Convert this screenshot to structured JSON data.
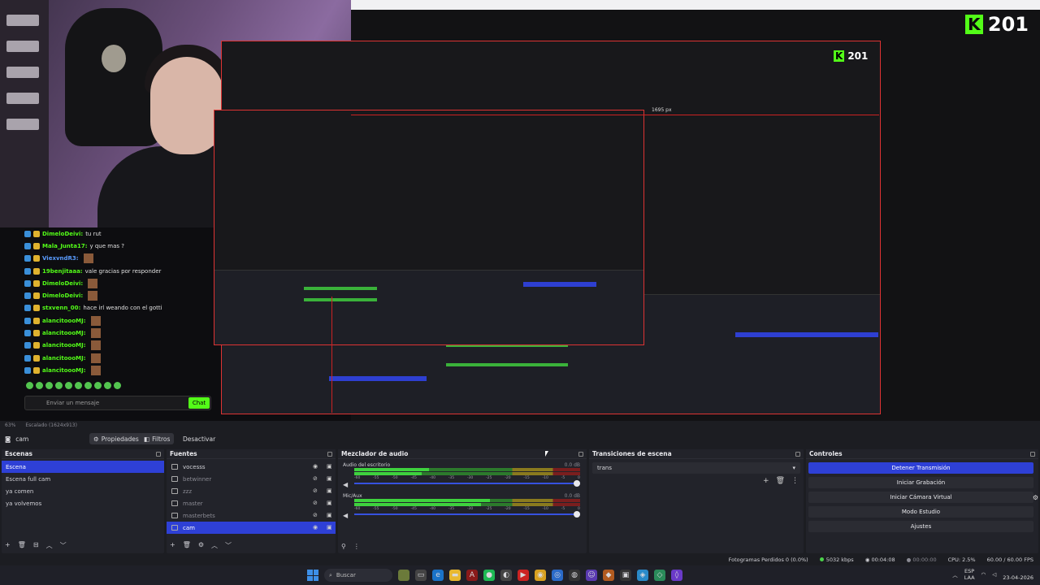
{
  "capture": {
    "kick_count": "201",
    "nested_kick_count": "201",
    "ruler_label": "1695 px",
    "chat_messages": [
      {
        "user": "DimeloDeivi:",
        "text": "tu rut",
        "color": "green"
      },
      {
        "user": "Mala_Junta17:",
        "text": "y que mas ?",
        "color": "green"
      },
      {
        "user": "ViexvndR3:",
        "text": "",
        "color": "blue"
      },
      {
        "user": "19benjitaaa:",
        "text": "vale gracias por responder",
        "color": "green"
      },
      {
        "user": "DimeloDeivi:",
        "text": "",
        "color": "green"
      },
      {
        "user": "DimeloDeivi:",
        "text": "",
        "color": "green"
      },
      {
        "user": "stxvenn_00:",
        "text": "hace irl weando con el gotti",
        "color": "green"
      },
      {
        "user": "alancitoooMJ:",
        "text": "",
        "color": "green"
      },
      {
        "user": "alancitoooMJ:",
        "text": "",
        "color": "green"
      },
      {
        "user": "alancitoooMJ:",
        "text": "",
        "color": "green"
      },
      {
        "user": "alancitoooMJ:",
        "text": "",
        "color": "green"
      },
      {
        "user": "alancitoooMJ:",
        "text": "",
        "color": "green"
      }
    ],
    "chat_placeholder": "Enviar un mensaje",
    "chat_button": "Chat"
  },
  "status_mini": {
    "zoom": "63%",
    "scaled": "Escalado (1624x913)"
  },
  "toolbar": {
    "source_name": "cam",
    "properties": "Propiedades",
    "filters": "Filtros",
    "deactivate": "Desactivar"
  },
  "scenes": {
    "title": "Escenas",
    "items": [
      "Escena",
      "Escena full cam",
      "ya comen",
      "ya volvemos"
    ],
    "selected": 0
  },
  "sources": {
    "title": "Fuentes",
    "items": [
      {
        "name": "vocesss",
        "visible": true
      },
      {
        "name": "betwinner",
        "visible": false
      },
      {
        "name": "zzz",
        "visible": false
      },
      {
        "name": "master",
        "visible": false
      },
      {
        "name": "masterbets",
        "visible": false
      },
      {
        "name": "cam",
        "visible": true
      }
    ],
    "selected": 5
  },
  "mixer": {
    "title": "Mezclador de audio",
    "tracks": [
      {
        "name": "Audio del escritorio",
        "db": "0.0 dB",
        "level": 0.33,
        "level2": 0.3
      },
      {
        "name": "Mic/Aux",
        "db": "0.0 dB",
        "level": 0.6,
        "level2": 0.56
      }
    ],
    "scale": [
      "-60",
      "-55",
      "-50",
      "-45",
      "-40",
      "-35",
      "-30",
      "-25",
      "-20",
      "-15",
      "-10",
      "-5",
      "0"
    ]
  },
  "transitions": {
    "title": "Transiciones de escena",
    "selected": "trans"
  },
  "controls": {
    "title": "Controles",
    "stop_stream": "Detener Transmisión",
    "start_recording": "Iniciar Grabación",
    "virtual_camera": "Iniciar Cámara Virtual",
    "studio_mode": "Modo Estudio",
    "settings": "Ajustes"
  },
  "status": {
    "dropped": "Fotogramas Perdidos 0 (0.0%)",
    "bitrate": "5032 kbps",
    "live_time": "00:04:08",
    "rec_time": "00:00:00",
    "cpu": "CPU: 2.5%",
    "fps": "60.00 / 60.00 FPS"
  },
  "taskbar": {
    "search": "Buscar",
    "lang1": "ESP",
    "lang2": "LAA",
    "date": "23-04-2026"
  },
  "colors": {
    "accent": "#2e40d6",
    "kick": "#53fc18",
    "panel": "#22232a"
  }
}
